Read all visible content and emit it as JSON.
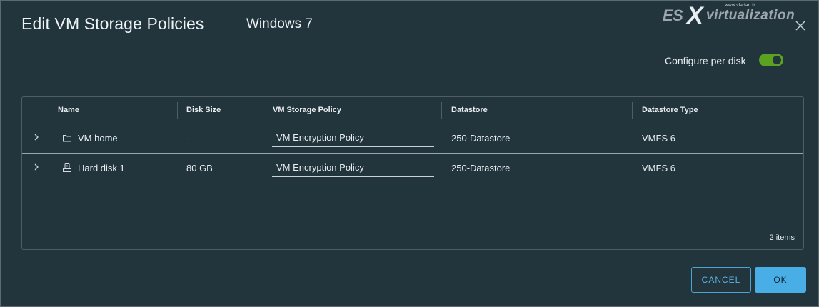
{
  "dialog": {
    "title": "Edit VM Storage Policies",
    "subtitle": "Windows 7",
    "close_icon": "close-icon"
  },
  "watermark": {
    "url": "www.vladan.fr",
    "brand_es": "ES",
    "brand_x": "X",
    "brand_rest": "virtualization"
  },
  "toggle": {
    "label": "Configure per disk",
    "on": true,
    "color": "#5aa220"
  },
  "grid": {
    "columns": [
      "Name",
      "Disk Size",
      "VM Storage Policy",
      "Datastore",
      "Datastore Type"
    ],
    "rows": [
      {
        "icon": "folder-icon",
        "name": "VM home",
        "disk_size": "-",
        "policy": "VM Encryption Policy",
        "datastore": "250-Datastore",
        "datastore_type": "VMFS 6"
      },
      {
        "icon": "hard-disk-icon",
        "name": "Hard disk 1",
        "disk_size": "80 GB",
        "policy": "VM Encryption Policy",
        "datastore": "250-Datastore",
        "datastore_type": "VMFS 6"
      }
    ],
    "footer": "2 items"
  },
  "buttons": {
    "cancel": "CANCEL",
    "ok": "OK"
  },
  "colors": {
    "background": "#22343c",
    "accent": "#49aee6",
    "toggle_on": "#5aa220"
  }
}
